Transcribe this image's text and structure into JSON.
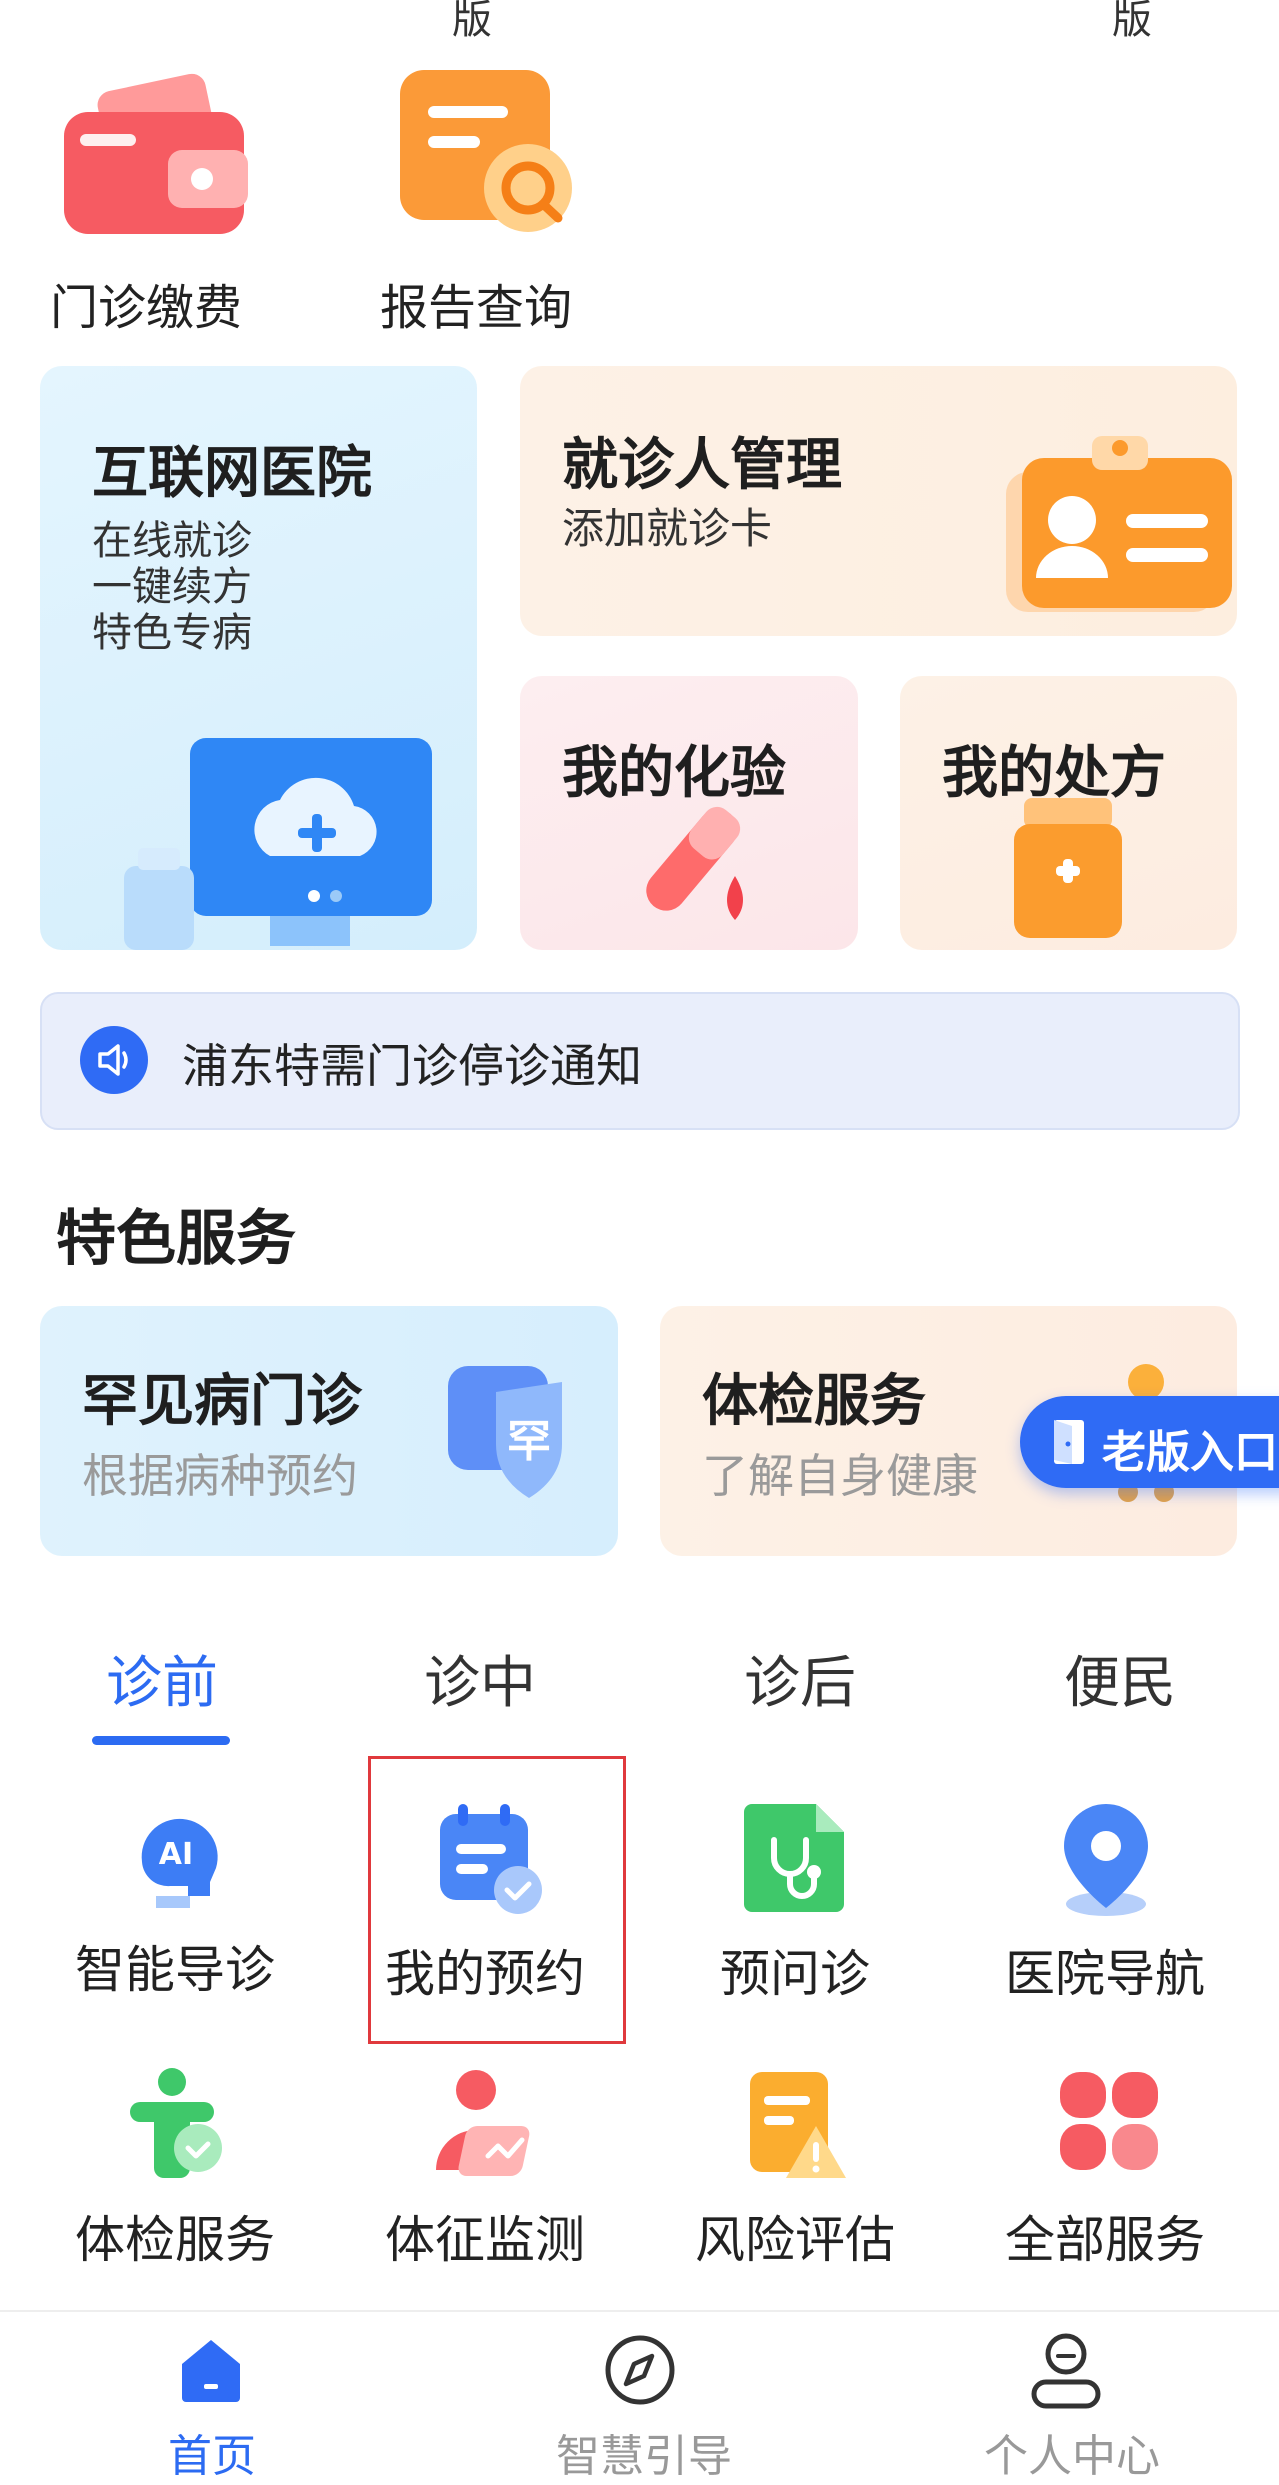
{
  "top_cutoff": [
    "版",
    "版"
  ],
  "quick_actions": [
    {
      "label": "门诊缴费",
      "icon": "wallet-icon"
    },
    {
      "label": "报告查询",
      "icon": "report-search-icon"
    }
  ],
  "cards": {
    "internet_hospital": {
      "title": "互联网医院",
      "lines": [
        "在线就诊",
        "一键续方",
        "特色专病"
      ],
      "icon": "cloud-medical-monitor-icon"
    },
    "patient_management": {
      "title": "就诊人管理",
      "subtitle": "添加就诊卡",
      "icon": "id-card-icon"
    },
    "my_lab": {
      "title": "我的化验",
      "icon": "test-tube-icon"
    },
    "my_prescription": {
      "title": "我的处方",
      "icon": "medicine-bottle-icon"
    }
  },
  "notice": {
    "text": "浦东特需门诊停诊通知",
    "icon": "speaker-icon"
  },
  "featured": {
    "title": "特色服务",
    "items": [
      {
        "title": "罕见病门诊",
        "subtitle": "根据病种预约",
        "icon": "shield-rare-icon"
      },
      {
        "title": "体检服务",
        "subtitle": "了解自身健康",
        "icon": "person-icon"
      }
    ]
  },
  "old_version": {
    "label": "老版入口",
    "icon": "door-icon"
  },
  "tabs": [
    {
      "label": "诊前",
      "active": true
    },
    {
      "label": "诊中",
      "active": false
    },
    {
      "label": "诊后",
      "active": false
    },
    {
      "label": "便民",
      "active": false
    }
  ],
  "services": [
    {
      "label": "智能导诊",
      "icon": "ai-head-icon"
    },
    {
      "label": "我的预约",
      "icon": "calendar-check-icon"
    },
    {
      "label": "预问诊",
      "icon": "stethoscope-doc-icon"
    },
    {
      "label": "医院导航",
      "icon": "location-pin-icon"
    },
    {
      "label": "体检服务",
      "icon": "body-check-icon"
    },
    {
      "label": "体征监测",
      "icon": "vital-monitor-icon"
    },
    {
      "label": "风险评估",
      "icon": "risk-warning-icon"
    },
    {
      "label": "全部服务",
      "icon": "all-services-icon"
    }
  ],
  "bottom_nav": [
    {
      "label": "首页",
      "icon": "home-icon",
      "active": true
    },
    {
      "label": "智慧引导",
      "icon": "compass-icon",
      "active": false
    },
    {
      "label": "个人中心",
      "icon": "user-icon",
      "active": false
    }
  ],
  "colors": {
    "primary": "#2c6bf2",
    "card_blue_bg": "#dff2fd",
    "card_orange_bg": "#fdf0e4",
    "card_pink_bg": "#fdeced",
    "notice_bg": "#e9eefb",
    "highlight_border": "#e0393d"
  }
}
